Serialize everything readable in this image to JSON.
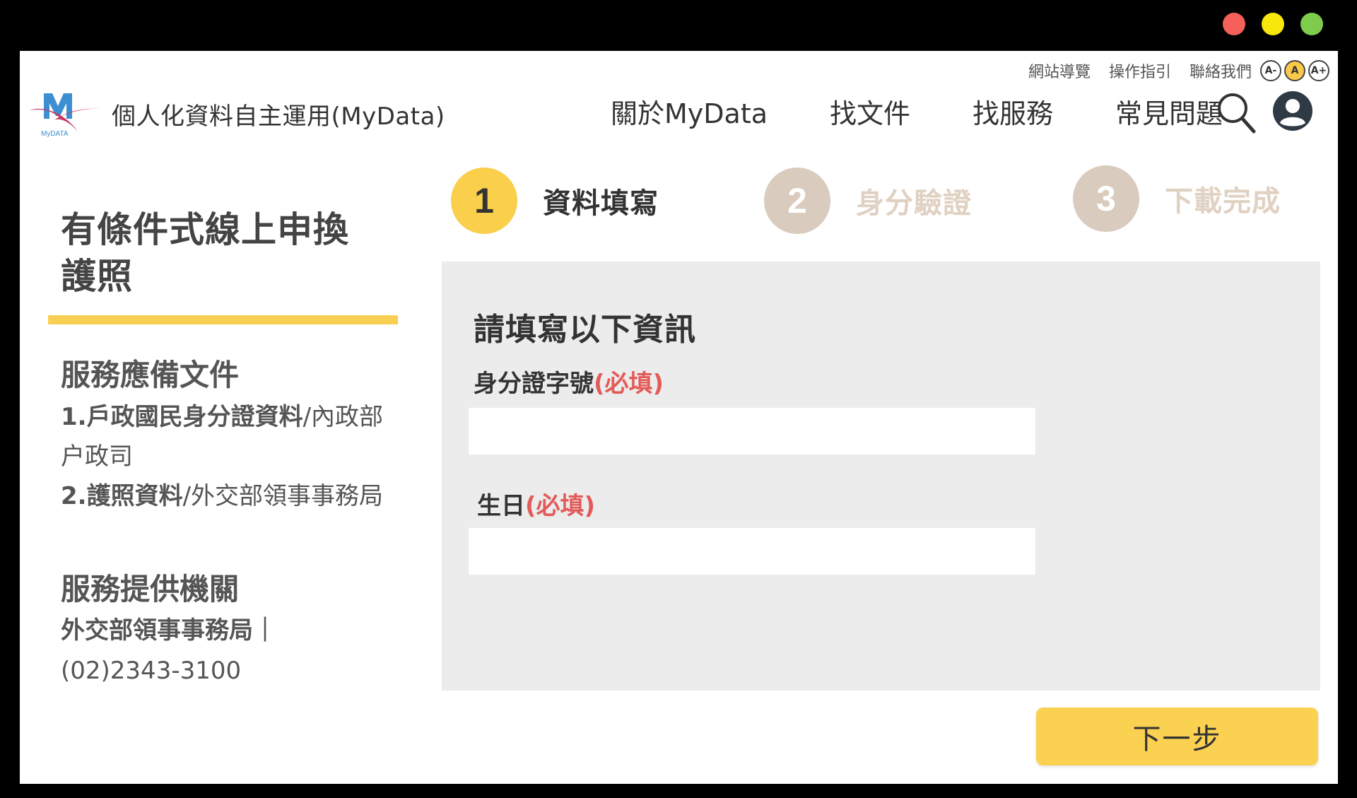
{
  "window": {
    "controls": {
      "close_color": "#f5605a",
      "minimize_color": "#f6e80c",
      "maximize_color": "#7fcb4e"
    }
  },
  "header": {
    "logo_text": "MyDATA",
    "site_title": "個人化資料自主運用(MyData)",
    "util_links": [
      "網站導覽",
      "操作指引",
      "聯絡我們"
    ],
    "font_size_buttons": [
      "A-",
      "A",
      "A+"
    ],
    "nav": [
      "關於MyData",
      "找文件",
      "找服務",
      "常見問題"
    ],
    "icons": [
      "search-icon",
      "user-account-icon"
    ]
  },
  "sidebar": {
    "title": "有條件式線上申換護照",
    "documents_heading": "服務應備文件",
    "documents": [
      {
        "name": "1.戶政國民身分證資料",
        "agency": "/內政部户政司"
      },
      {
        "name": "2.護照資料",
        "agency": "/外交部領事事務局"
      }
    ],
    "provider_heading": "服務提供機關",
    "provider_name": "外交部領事事務局｜",
    "provider_phone": "(02)2343-3100"
  },
  "steps": [
    {
      "number": "1",
      "label": "資料填寫",
      "state": "active"
    },
    {
      "number": "2",
      "label": "身分驗證",
      "state": "inactive"
    },
    {
      "number": "3",
      "label": "下載完成",
      "state": "inactive"
    }
  ],
  "form": {
    "title": "請填寫以下資訊",
    "id_label": "身分證字號",
    "id_required": "(必填)",
    "id_value": "",
    "birthday_label": "生日",
    "birthday_required": "(必填)",
    "birthday_value": ""
  },
  "actions": {
    "next_label": "下一步"
  },
  "colors": {
    "accent_yellow": "#f9cf4c",
    "inactive_step": "#d9cbbd",
    "required_red": "#e35b58",
    "panel_gray": "#ececec"
  }
}
